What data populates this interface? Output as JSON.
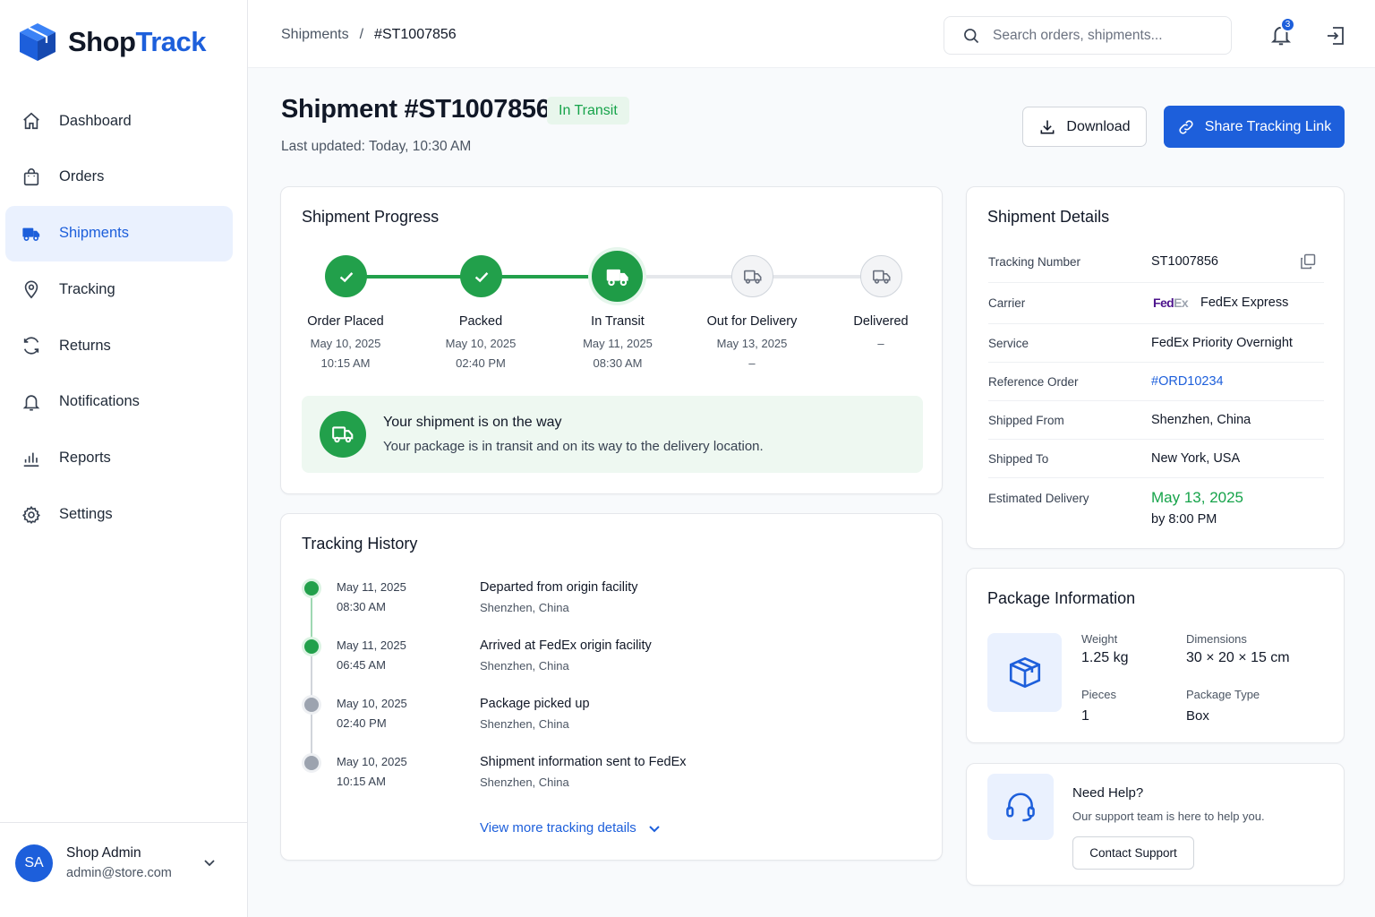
{
  "app": {
    "brand_part1": "Shop",
    "brand_part2": "Track",
    "accent_color": "#1d5fdb",
    "success_color": "#22a04b"
  },
  "sidebar": {
    "items": [
      {
        "label": "Dashboard",
        "icon": "home-icon",
        "active": false
      },
      {
        "label": "Orders",
        "icon": "shopping-bag-icon",
        "active": false
      },
      {
        "label": "Shipments",
        "icon": "truck-icon",
        "active": true
      },
      {
        "label": "Tracking",
        "icon": "map-pin-icon",
        "active": false
      },
      {
        "label": "Returns",
        "icon": "refresh-icon",
        "active": false
      },
      {
        "label": "Notifications",
        "icon": "bell-icon",
        "active": false
      },
      {
        "label": "Reports",
        "icon": "bar-chart-icon",
        "active": false
      },
      {
        "label": "Settings",
        "icon": "gear-icon",
        "active": false
      }
    ],
    "user": {
      "initials": "SA",
      "name": "Shop Admin",
      "email": "admin@store.com"
    }
  },
  "header": {
    "breadcrumb": {
      "parent": "Shipments",
      "separator": "/",
      "current": "#ST1007856"
    },
    "search_placeholder": "Search orders, shipments...",
    "notification_count": "3"
  },
  "page": {
    "title": "Shipment #ST1007856",
    "status": "In Transit",
    "last_updated": "Last updated: Today, 10:30 AM",
    "download_label": "Download",
    "share_label": "Share Tracking Link"
  },
  "progress": {
    "title": "Shipment Progress",
    "steps": [
      {
        "label": "Order Placed",
        "date": "May 10, 2025",
        "time": "10:15 AM",
        "state": "done"
      },
      {
        "label": "Packed",
        "date": "May 10, 2025",
        "time": "02:40 PM",
        "state": "done"
      },
      {
        "label": "In Transit",
        "date": "May 11, 2025",
        "time": "08:30 AM",
        "state": "current"
      },
      {
        "label": "Out for Delivery",
        "date": "May 13, 2025",
        "time": "–",
        "state": "pending"
      },
      {
        "label": "Delivered",
        "date": "–",
        "time": "",
        "state": "pending"
      }
    ],
    "banner_title": "Your shipment is on the way",
    "banner_text": "Your package is in transit and on its way to the delivery location."
  },
  "history": {
    "title": "Tracking History",
    "events": [
      {
        "date": "May 11, 2025",
        "time": "08:30 AM",
        "event": "Departed from origin facility",
        "location": "Shenzhen, China",
        "state": "green"
      },
      {
        "date": "May 11, 2025",
        "time": "06:45 AM",
        "event": "Arrived at FedEx origin facility",
        "location": "Shenzhen, China",
        "state": "green"
      },
      {
        "date": "May 10, 2025",
        "time": "02:40 PM",
        "event": "Package picked up",
        "location": "Shenzhen, China",
        "state": "grey"
      },
      {
        "date": "May 10, 2025",
        "time": "10:15 AM",
        "event": "Shipment information sent to FedEx",
        "location": "Shenzhen, China",
        "state": "grey"
      }
    ],
    "view_more_label": "View more tracking details"
  },
  "details": {
    "title": "Shipment Details",
    "tracking_number_label": "Tracking Number",
    "tracking_number": "ST1007856",
    "carrier_label": "Carrier",
    "carrier_logo_fe": "Fed",
    "carrier_logo_ex": "Ex",
    "carrier": "FedEx Express",
    "service_label": "Service",
    "service": "FedEx Priority Overnight",
    "reference_label": "Reference Order",
    "reference": "#ORD10234",
    "from_label": "Shipped From",
    "from": "Shenzhen, China",
    "to_label": "Shipped To",
    "to": "New York, USA",
    "eta_label": "Estimated Delivery",
    "eta_date": "May 13, 2025",
    "eta_time": "by 8:00 PM"
  },
  "package": {
    "title": "Package Information",
    "weight_label": "Weight",
    "weight": "1.25 kg",
    "dimensions_label": "Dimensions",
    "dimensions": "30 × 20 × 15 cm",
    "pieces_label": "Pieces",
    "pieces": "1",
    "type_label": "Package Type",
    "type": "Box"
  },
  "help": {
    "title": "Need Help?",
    "text": "Our support team is here to help you.",
    "button": "Contact Support"
  }
}
